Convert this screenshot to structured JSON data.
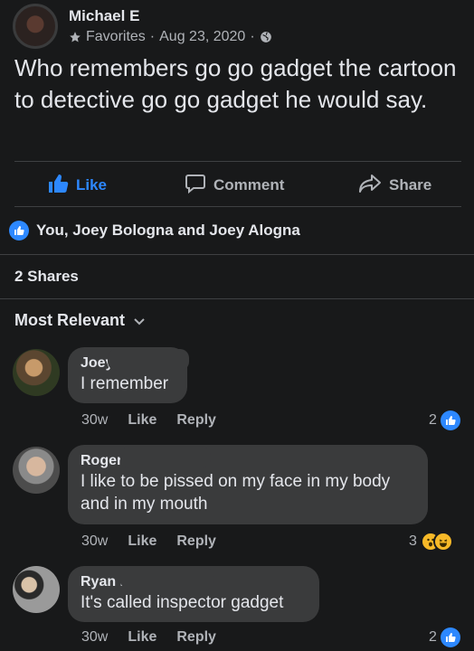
{
  "post": {
    "author": "Michael E",
    "audience": "Favorites",
    "separator": "·",
    "date": "Aug 23, 2020",
    "text": "Who remembers go go gadget the cartoon to detective go go gadget he would say."
  },
  "actions": {
    "like": "Like",
    "comment": "Comment",
    "share": "Share"
  },
  "reactions_summary": "You, Joey Bologna and Joey Alogna",
  "shares": "2 Shares",
  "sort_label": "Most Relevant",
  "comments": [
    {
      "name": "Joey B.",
      "text": "I remember",
      "time": "30w",
      "like": "Like",
      "reply": "Reply",
      "reaction_count": "2",
      "reaction_type": "like"
    },
    {
      "name": "Roger S",
      "text": "I like to be pissed on my face in my body and in my mouth",
      "time": "30w",
      "like": "Like",
      "reply": "Reply",
      "reaction_count": "3",
      "reaction_type": "wow-haha"
    },
    {
      "name": "Ryan H.",
      "text": "It's called inspector gadget",
      "time": "30w",
      "like": "Like",
      "reply": "Reply",
      "reaction_count": "2",
      "reaction_type": "like"
    }
  ],
  "colors": {
    "background": "#18191a",
    "bubble": "#3a3b3c",
    "accent": "#2d88ff",
    "muted": "#b0b3b8",
    "text": "#e4e6eb"
  },
  "icons": [
    "star-icon",
    "globe-icon",
    "thumbs-up-icon",
    "comment-icon",
    "share-arrow-icon",
    "chevron-down-icon",
    "wow-emoji-icon",
    "haha-emoji-icon"
  ]
}
